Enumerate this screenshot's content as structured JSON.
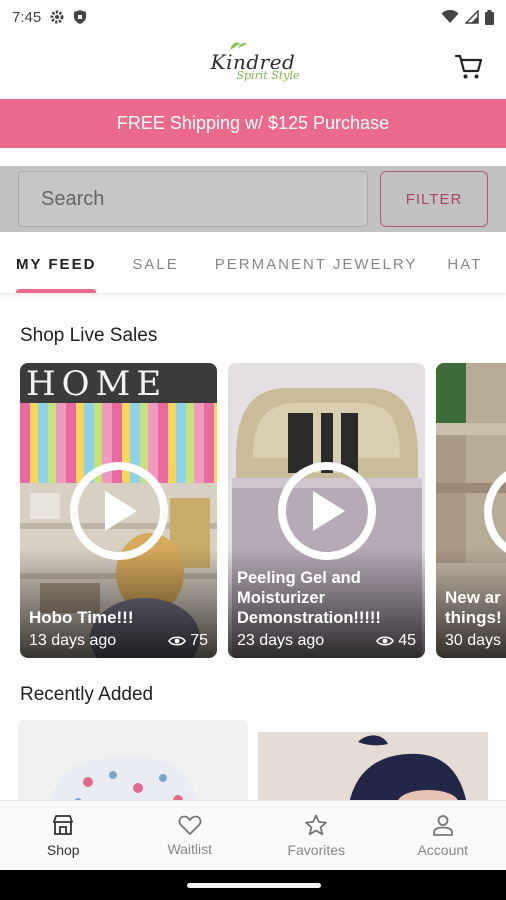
{
  "status_bar": {
    "time": "7:45"
  },
  "header": {
    "logo_main": "Kindred",
    "logo_sub": "Spirit Style"
  },
  "promo": {
    "text": "FREE Shipping w/ $125 Purchase"
  },
  "search": {
    "placeholder": "Search",
    "filter_label": "FILTER"
  },
  "tabs": [
    {
      "label": "MY FEED",
      "active": true
    },
    {
      "label": "SALE",
      "active": false
    },
    {
      "label": "PERMANENT JEWELRY",
      "active": false
    },
    {
      "label": "HAT",
      "active": false
    }
  ],
  "live_sales": {
    "title": "Shop Live Sales",
    "cards": [
      {
        "title": "Hobo Time!!!",
        "age": "13 days ago",
        "views": "75"
      },
      {
        "title": "Peeling Gel and Moisturizer Demonstration!!!!!",
        "age": "23 days ago",
        "views": "45"
      },
      {
        "title": "New ar things!",
        "age": "30 days",
        "views": ""
      }
    ]
  },
  "recently_added": {
    "title": "Recently Added"
  },
  "bottom_nav": [
    {
      "label": "Shop",
      "icon": "shop-icon",
      "active": true
    },
    {
      "label": "Waitlist",
      "icon": "heart-icon",
      "active": false
    },
    {
      "label": "Favorites",
      "icon": "star-icon",
      "active": false
    },
    {
      "label": "Account",
      "icon": "person-icon",
      "active": false
    }
  ],
  "colors": {
    "accent": "#ea6a8c",
    "filter_border": "#b55a70"
  }
}
